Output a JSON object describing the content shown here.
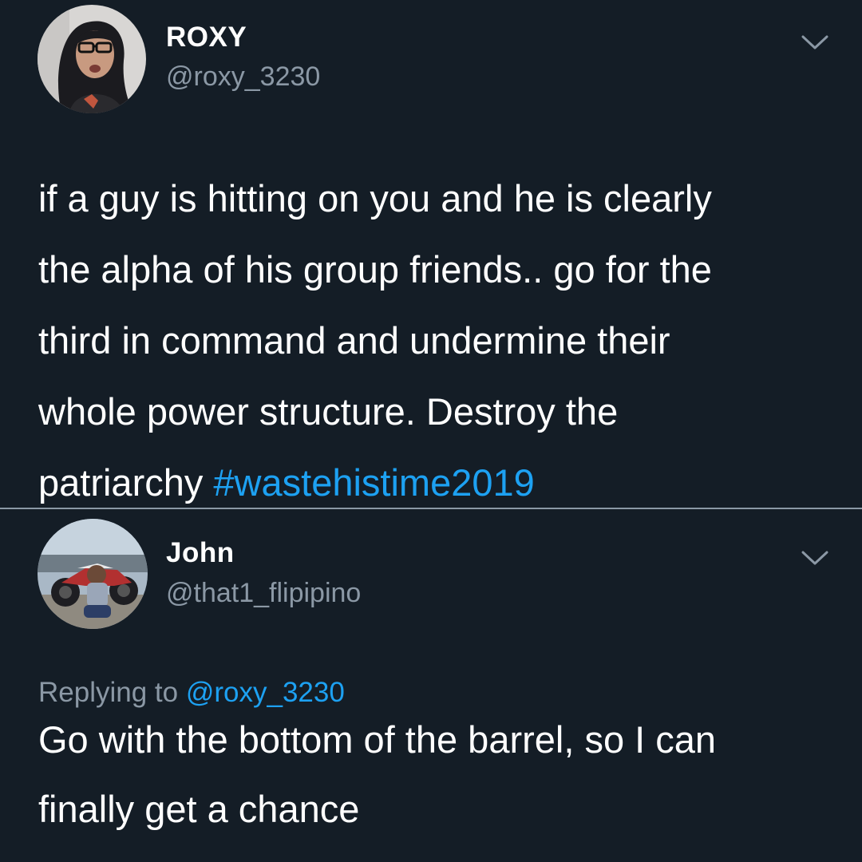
{
  "tweets": [
    {
      "display_name": "ROXY",
      "handle": "@roxy_3230",
      "text": "if a guy is hitting on you and he is clearly\nthe alpha of his group friends.. go for the\nthird in command and undermine their\nwhole power structure. Destroy the\npatriarchy  ",
      "hashtag": "#wastehistime2019",
      "avatar_icon": "profile-photo",
      "menu_icon": "chevron-down-icon"
    },
    {
      "display_name": "John",
      "handle": "@that1_flipipino",
      "replying_prefix": "Replying to ",
      "replying_to": "@roxy_3230",
      "text": "Go with the bottom of the barrel, so I can\nfinally get a chance",
      "avatar_icon": "profile-photo",
      "menu_icon": "chevron-down-icon"
    }
  ],
  "colors": {
    "background": "#141d26",
    "text": "#ffffff",
    "secondary_text": "#8b98a5",
    "link": "#1da1f2"
  }
}
